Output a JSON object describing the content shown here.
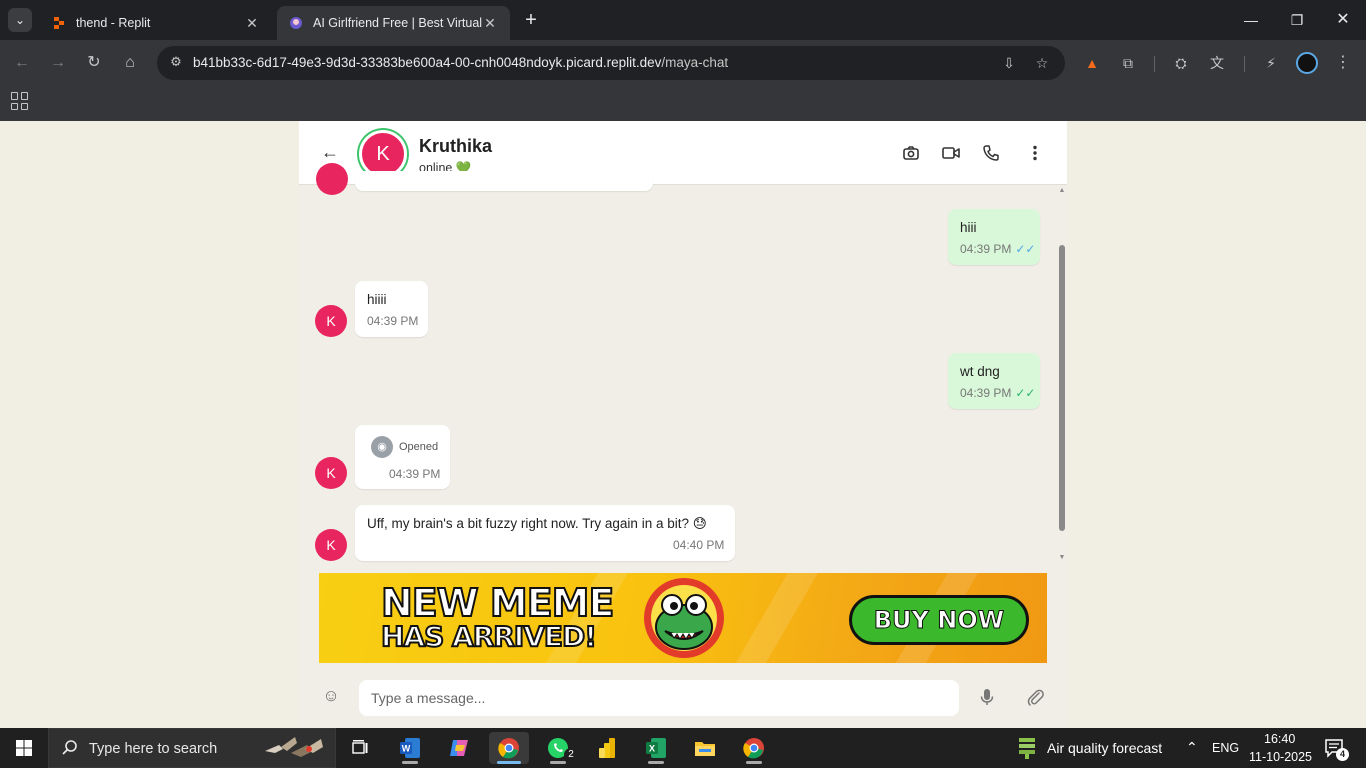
{
  "browser": {
    "tabs": [
      {
        "title": "thend - Replit",
        "active": false
      },
      {
        "title": "AI Girlfriend Free | Best Virtual C",
        "active": true
      }
    ],
    "url_host": "b41bb33c-6d17-49e3-9d3d-33383be600a4-00-cnh0048ndoyk.picard.replit.dev",
    "url_path": "/maya-chat"
  },
  "chat": {
    "contact_name": "Kruthika",
    "avatar_letter": "K",
    "status": "online",
    "status_emoji": "💚",
    "messages": [
      {
        "direction": "out",
        "text": "hiii",
        "time": "04:39 PM",
        "tick": "✓✓"
      },
      {
        "direction": "in",
        "text": "hiiii",
        "time": "04:39 PM"
      },
      {
        "direction": "out",
        "text": "wt dng",
        "time": "04:39 PM",
        "tick": "✓✓"
      },
      {
        "direction": "in",
        "text": "Opened",
        "time": "04:39 PM"
      },
      {
        "direction": "in",
        "text": "Uff, my brain's a bit fuzzy right now. Try again in a bit? 😓",
        "time": "04:40 PM"
      }
    ],
    "input_placeholder": "Type a message..."
  },
  "ad": {
    "line1": "NEW MEME",
    "line2": "HAS ARRIVED!",
    "button": "BUY NOW"
  },
  "taskbar": {
    "search_placeholder": "Type here to search",
    "whatsapp_badge": "2",
    "weather": "Air quality forecast",
    "language": "ENG",
    "time": "16:40",
    "date": "11-10-2025",
    "notifications": "4"
  },
  "colors": {
    "avatar": "#e8255e",
    "outgoing_bubble": "#d9f8d9",
    "chat_background": "#f0eee6",
    "online_ring": "#3cc46b"
  }
}
